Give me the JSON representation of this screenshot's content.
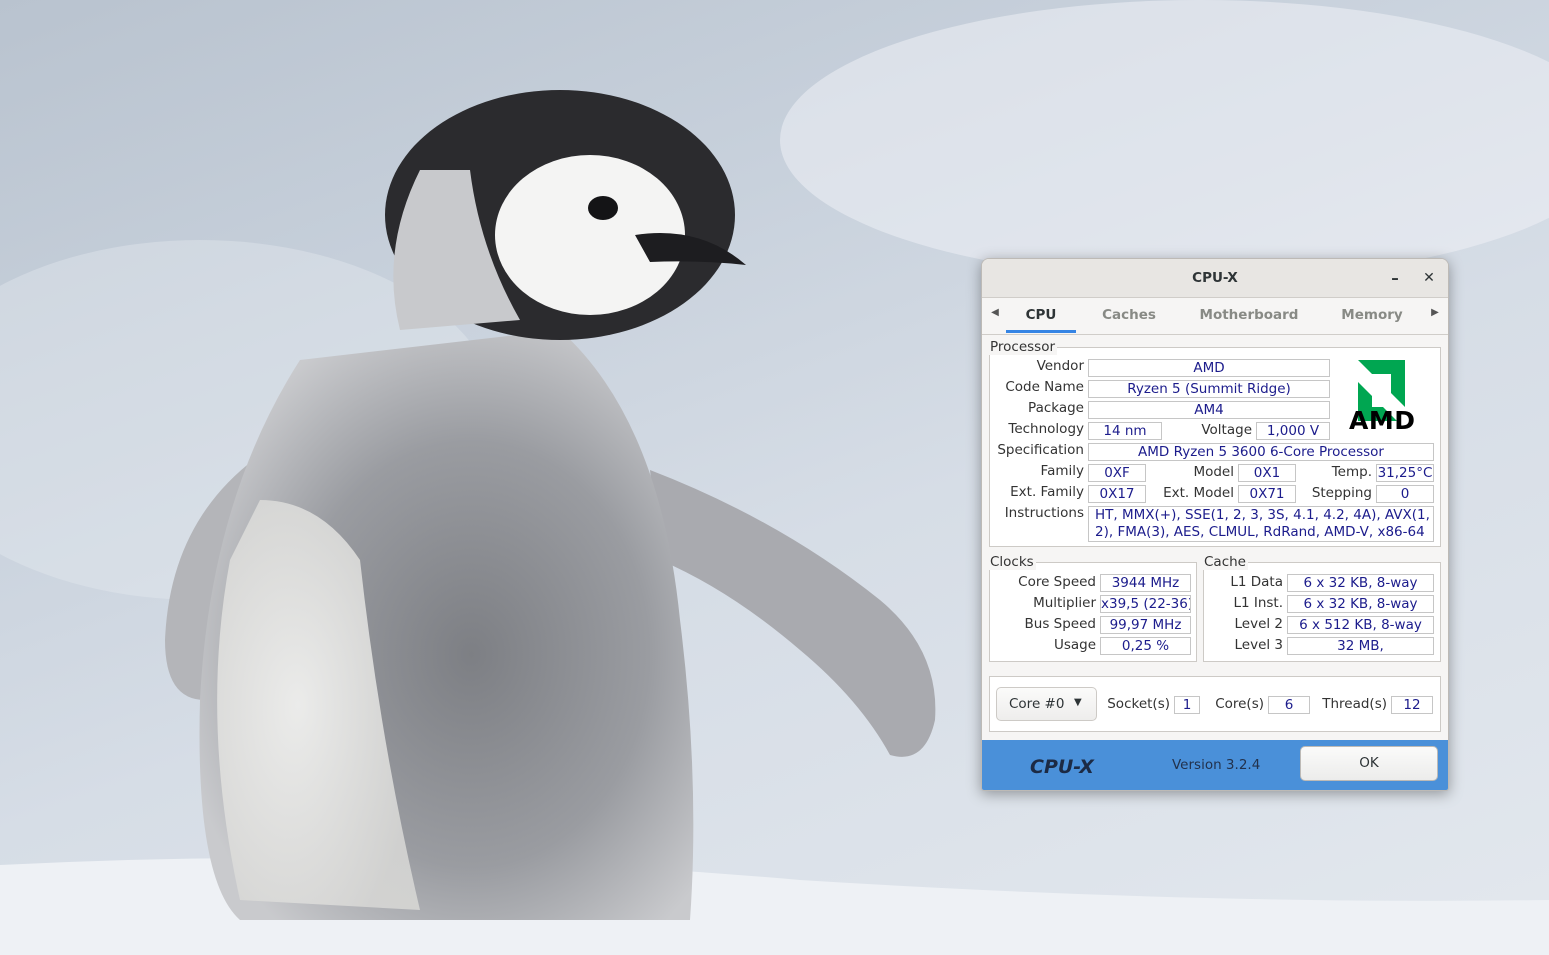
{
  "window": {
    "title": "CPU-X",
    "minimize_label": "–",
    "close_label": "✕"
  },
  "tabs": [
    "CPU",
    "Caches",
    "Motherboard",
    "Memory"
  ],
  "processor": {
    "title": "Processor",
    "vendor_label": "Vendor",
    "vendor": "AMD",
    "codename_label": "Code Name",
    "codename": "Ryzen 5 (Summit Ridge)",
    "package_label": "Package",
    "package": "AM4",
    "technology_label": "Technology",
    "technology": "14 nm",
    "voltage_label": "Voltage",
    "voltage": "1,000 V",
    "spec_label": "Specification",
    "spec": "AMD Ryzen 5 3600 6-Core Processor",
    "family_label": "Family",
    "family": "0XF",
    "model_label": "Model",
    "model": "0X1",
    "temp_label": "Temp.",
    "temp": "31,25°C",
    "extfamily_label": "Ext. Family",
    "extfamily": "0X17",
    "extmodel_label": "Ext. Model",
    "extmodel": "0X71",
    "stepping_label": "Stepping",
    "stepping": "0",
    "instructions_label": "Instructions",
    "instructions": "HT, MMX(+), SSE(1, 2, 3, 3S, 4.1, 4.2, 4A), AVX(1, 2), FMA(3), AES, CLMUL, RdRand, AMD-V, x86-64",
    "logo_text": "AMD",
    "logo_color": "#00a651"
  },
  "clocks": {
    "title": "Clocks",
    "core_speed_label": "Core Speed",
    "core_speed": "3944 MHz",
    "multiplier_label": "Multiplier",
    "multiplier": "x39,5 (22-36)",
    "bus_speed_label": "Bus Speed",
    "bus_speed": "99,97 MHz",
    "usage_label": "Usage",
    "usage": "0,25 %"
  },
  "cache": {
    "title": "Cache",
    "l1d_label": "L1 Data",
    "l1d": "6 x 32 KB, 8-way",
    "l1i_label": "L1 Inst.",
    "l1i": "6 x 32 KB, 8-way",
    "l2_label": "Level 2",
    "l2": "6 x 512 KB, 8-way",
    "l3_label": "Level 3",
    "l3": "32 MB,"
  },
  "bottom": {
    "core_select": "Core #0",
    "sockets_label": "Socket(s)",
    "sockets": "1",
    "cores_label": "Core(s)",
    "cores": "6",
    "threads_label": "Thread(s)",
    "threads": "12"
  },
  "footer": {
    "brand": "CPU-X",
    "version": "Version 3.2.4",
    "ok_label": "OK",
    "color": "#4a90d9"
  },
  "icons": {
    "tab_left": "left-triangle-icon",
    "tab_right": "right-triangle-icon",
    "combo_arrow": "down-triangle-icon"
  }
}
